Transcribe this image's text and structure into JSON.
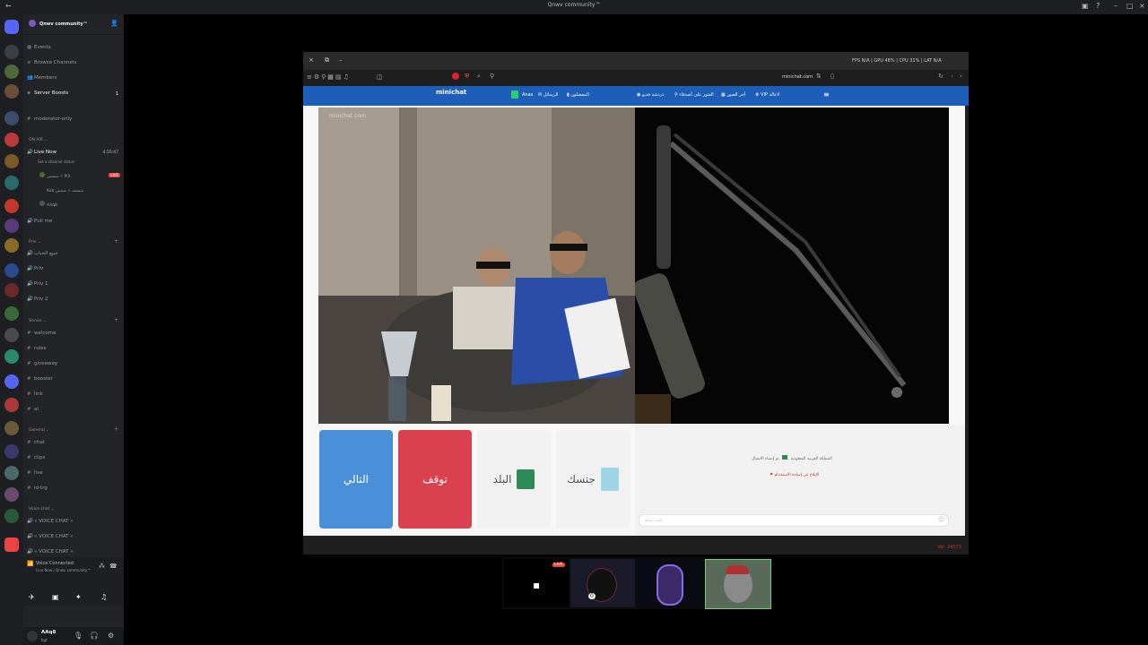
{
  "window": {
    "title": "Qnwv community™"
  },
  "server": {
    "name": "Qnwv community™",
    "boosts_badge": "1"
  },
  "channels": {
    "top": [
      {
        "label": "Events",
        "icon": "calendar-icon"
      },
      {
        "label": "Browse Channels",
        "icon": "list-icon"
      },
      {
        "label": "Members",
        "icon": "members-icon"
      },
      {
        "label": "Server Boosts",
        "icon": "boost-icon"
      },
      {
        "label": "moderator-only",
        "icon": "hash-icon"
      }
    ],
    "on_air": {
      "category": "ON AIR",
      "live_now": "Live Now",
      "live_sub": "Set a channel status",
      "timer": "4:55:47",
      "users": [
        "سسس ⚡ PIX",
        "Kob شششـ ⚡ شمس",
        "AAq8"
      ],
      "live_badge": "LIVE",
      "pull_me": "Pull me"
    },
    "priv": {
      "category": "Priv",
      "items": [
        "حبيع الحباب",
        "Priv",
        "Priv 1",
        "Priv 2"
      ]
    },
    "server_cat": {
      "category": "Server",
      "items": [
        "welcome",
        "rules",
        "giveaway",
        "booster",
        "link",
        "ai"
      ]
    },
    "general": {
      "category": "General",
      "items": [
        "chat",
        "clips",
        "live",
        "id-trg"
      ]
    },
    "voice": {
      "category": "Voice chat",
      "items": [
        "« VOICE CHAT »",
        "« VOICE CHAT »",
        "« VOICE CHAT »"
      ]
    }
  },
  "voice_panel": {
    "status": "Voice Connected",
    "sub": "Live Now / Qnwv community™"
  },
  "user_panel": {
    "name": "AAq8",
    "sub": "bgt"
  },
  "browser": {
    "toolbar_right": "FPS N/A | GPU 48% | CPU 31% | LAT N/A",
    "url": "minichat.com",
    "site_logo": "minichat",
    "nav": {
      "user": "Anas",
      "messages": "الرسائل",
      "favorites": "المفضلون",
      "voice_call": "دردشة فديو",
      "search": "العثور على أصدقاء",
      "photos": "أخر الصور",
      "vip": "VIP لاعالة"
    },
    "buttons": {
      "next": "التالي",
      "stop": "توقف",
      "country": "البلد",
      "gender": "جنسك"
    },
    "chat": {
      "line1": "تم إنشاء الاتصال",
      "line1_country": "المملكة العربية السعودية",
      "line2": "الإبلاغ عن إساءة الاستخدام",
      "input_placeholder": "اكتب رسالة"
    },
    "watermark": "minichat.com",
    "version": "Ver. 24573"
  },
  "dock": {
    "live_badge": "LIVE",
    "badge_count": "0"
  }
}
